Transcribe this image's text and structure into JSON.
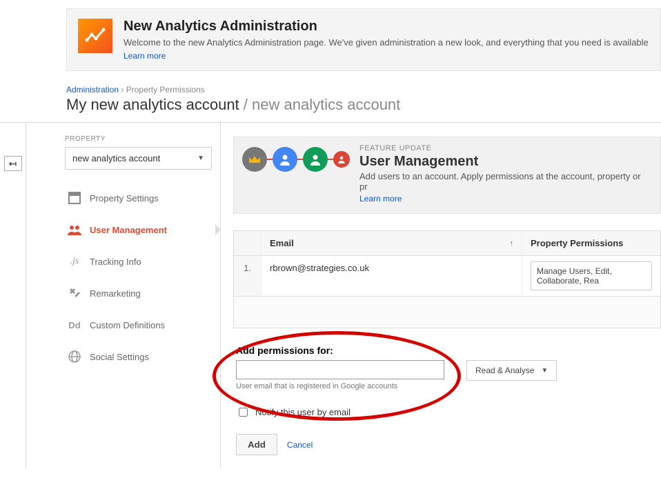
{
  "banner": {
    "title": "New Analytics Administration",
    "body": "Welcome to the new Analytics Administration page. We've given administration a new look, and everything that you need is available",
    "learn_more": "Learn more"
  },
  "breadcrumb": {
    "root": "Administration",
    "current": "Property Permissions"
  },
  "page": {
    "account_name": "My new analytics account",
    "separator": "/",
    "subtitle": "new analytics account"
  },
  "sidebar": {
    "section_label": "PROPERTY",
    "selected_property": "new analytics account",
    "items": [
      {
        "label": "Property Settings"
      },
      {
        "label": "User Management"
      },
      {
        "label": "Tracking Info"
      },
      {
        "label": "Remarketing"
      },
      {
        "label": "Custom Definitions"
      },
      {
        "label": "Social Settings"
      }
    ]
  },
  "feature": {
    "eyebrow": "FEATURE UPDATE",
    "title": "User Management",
    "body": "Add users to an account. Apply permissions at the account, property or pr",
    "learn_more": "Learn more"
  },
  "table": {
    "col_email": "Email",
    "col_perm": "Property Permissions",
    "rows": [
      {
        "idx": "1.",
        "email": "rbrown@strategies.co.uk",
        "perm": "Manage Users, Edit, Collaborate, Rea"
      }
    ]
  },
  "add": {
    "heading": "Add permissions for:",
    "hint": "User email that is registered in Google accounts",
    "perm_default": "Read & Analyse",
    "notify_label": "Notify this user by email",
    "add_btn": "Add",
    "cancel": "Cancel"
  }
}
